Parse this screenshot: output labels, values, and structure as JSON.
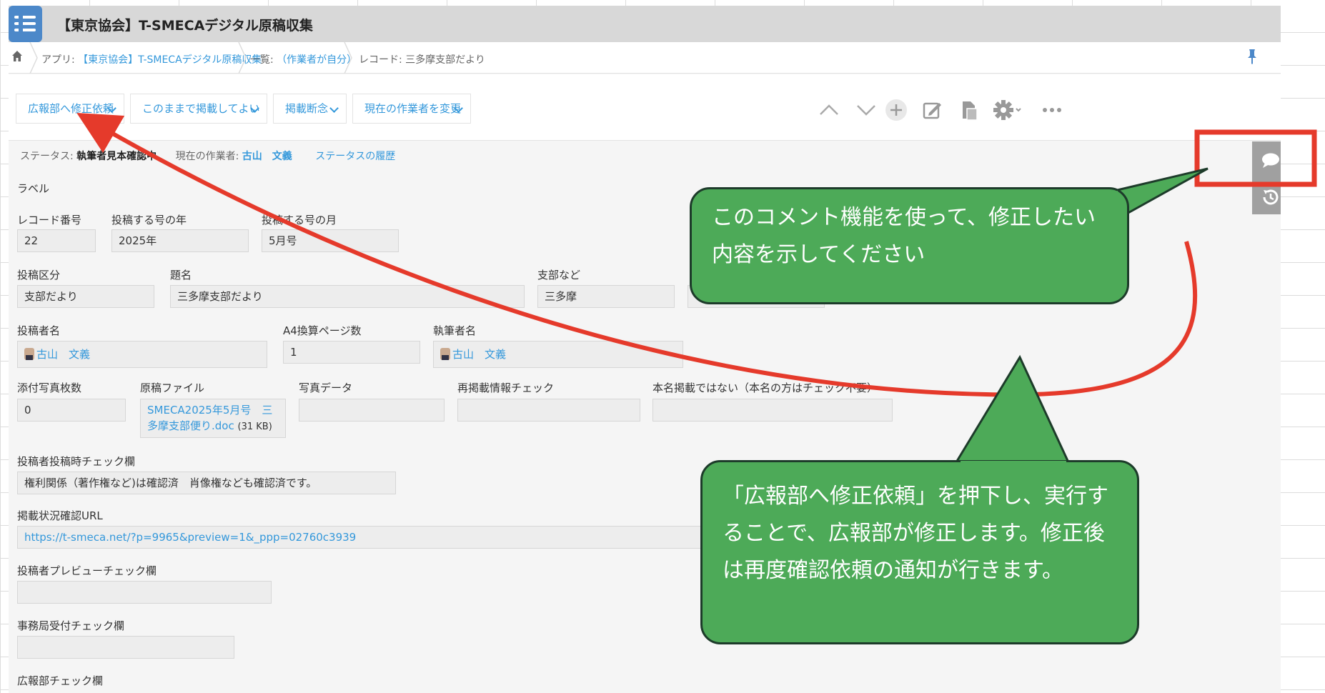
{
  "app_title": "【東京協会】T-SMECAデジタル原稿収集",
  "breadcrumb": {
    "app_prefix": "アプリ: ",
    "app_name": "【東京協会】T-SMECAデジタル原稿収集",
    "list_prefix": "一覧: ",
    "list_name": "（作業者が自分）",
    "record": "レコード: 三多摩支部だより"
  },
  "process_buttons": [
    "広報部へ修正依頼",
    "このままで掲載してよい",
    "掲載断念",
    "現在の作業者を変更"
  ],
  "status": {
    "label": "ステータス: ",
    "value": "執筆者見本確認中",
    "assignee_label": "現在の作業者: ",
    "assignee": "古山　文義",
    "history_link": "ステータスの履歴"
  },
  "fields": {
    "label_heading": "ラベル",
    "record_no": {
      "label": "レコード番号",
      "value": "22"
    },
    "issue_year": {
      "label": "投稿する号の年",
      "value": "2025年"
    },
    "issue_month": {
      "label": "投稿する号の月",
      "value": "5月号"
    },
    "category": {
      "label": "投稿区分",
      "value": "支部だより"
    },
    "title": {
      "label": "題名",
      "value": "三多摩支部だより"
    },
    "branch": {
      "label": "支部など",
      "value": "三多摩"
    },
    "poster": {
      "label": "投稿者名",
      "value": "古山　文義"
    },
    "pages": {
      "label": "A4換算ページ数",
      "value": "1"
    },
    "author": {
      "label": "執筆者名",
      "value": "古山　文義"
    },
    "photo_count": {
      "label": "添付写真枚数",
      "value": "0"
    },
    "manuscript": {
      "label": "原稿ファイル",
      "file_line1": "SMECA2025年5月号　三",
      "file_line2": "多摩支部便り.doc",
      "size": "(31 KB)"
    },
    "photo_data": {
      "label": "写真データ",
      "value": ""
    },
    "repost_check": {
      "label": "再掲載情報チェック",
      "value": ""
    },
    "pseudonym": {
      "label": "本名掲載ではない（本名の方はチェック不要）",
      "value": ""
    },
    "poster_check": {
      "label": "投稿者投稿時チェック欄",
      "value": "権利関係（著作権など)は確認済　肖像権なども確認済です。"
    },
    "url": {
      "label": "掲載状況確認URL",
      "value": "https://t-smeca.net/?p=9965&preview=1&_ppp=02760c3939"
    },
    "preview_check": {
      "label": "投稿者プレビューチェック欄",
      "value": ""
    },
    "office_check": {
      "label": "事務局受付チェック欄",
      "value": ""
    },
    "pr_check": {
      "label": "広報部チェック欄"
    }
  },
  "callouts": {
    "comment": "このコメント機能を使って、修正したい内容を示してください",
    "request": "「広報部へ修正依頼」を押下し、実行することで、広報部が修正します。修正後は再度確認依頼の通知が行きます。"
  },
  "colors": {
    "accent": "#3498db",
    "callout_fill": "#4daa58",
    "annotation_red": "#e53a2b"
  }
}
